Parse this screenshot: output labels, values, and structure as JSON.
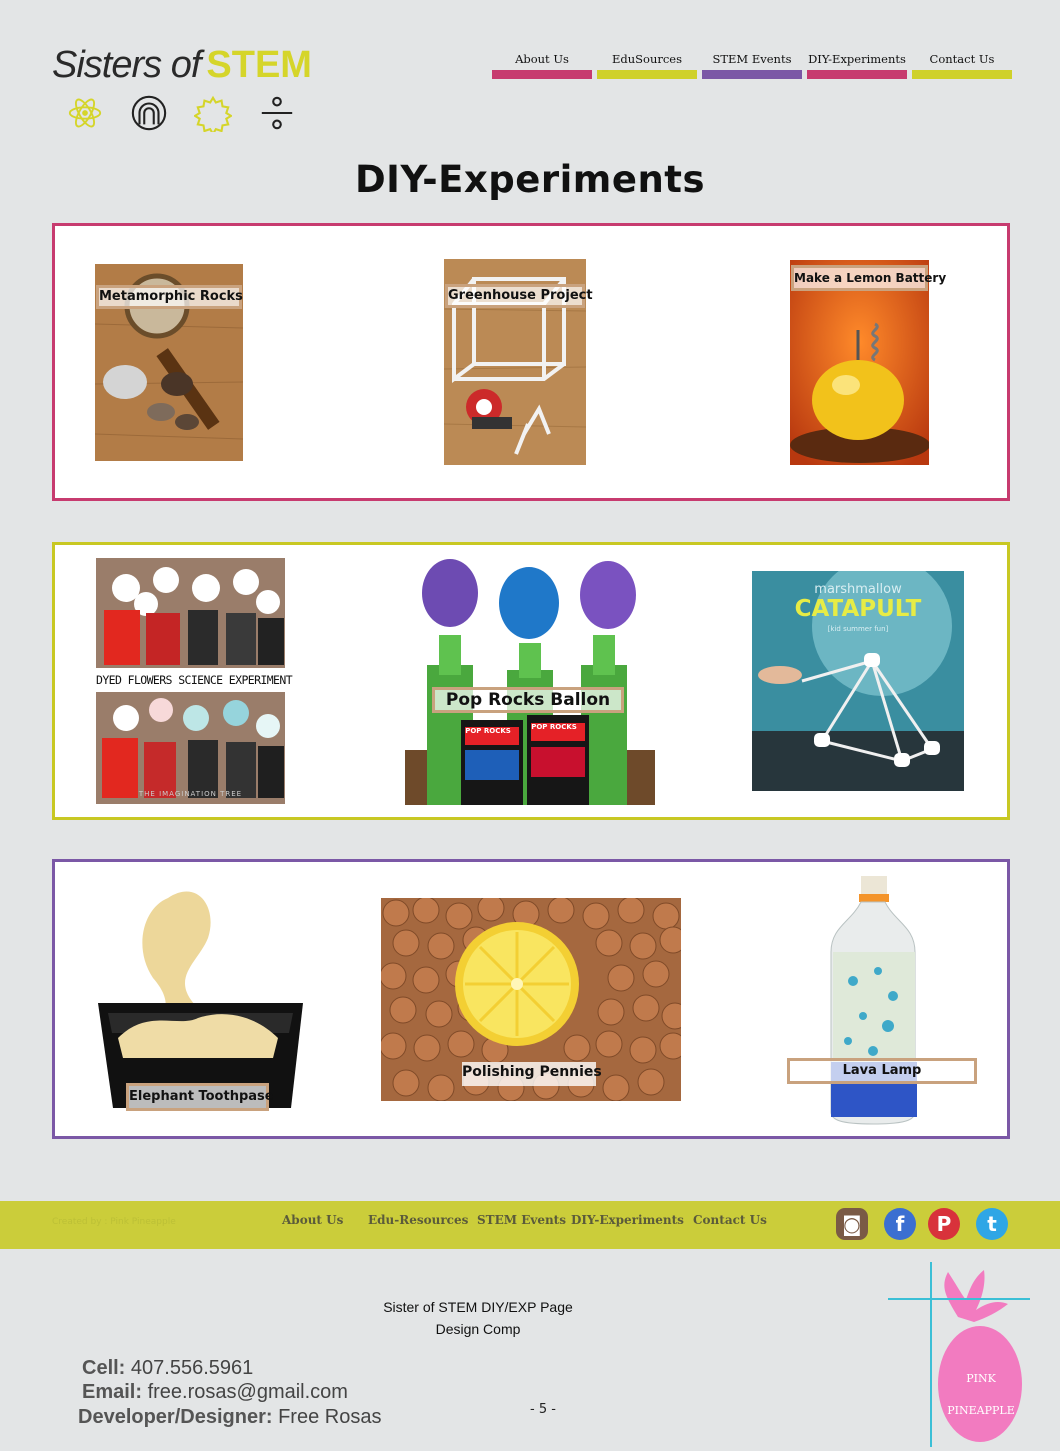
{
  "brand": {
    "name_prefix": "Sisters of",
    "name_accent": "STEM"
  },
  "nav": [
    {
      "label": "About Us",
      "color": "#c73b6f"
    },
    {
      "label": "EduSources",
      "color": "#cfd12a"
    },
    {
      "label": "STEM Events",
      "color": "#7b58a6"
    },
    {
      "label": "DIY-Experiments",
      "color": "#c73b6f"
    },
    {
      "label": "Contact Us",
      "color": "#cfd12a"
    }
  ],
  "page_title": "DIY-Experiments",
  "panels": [
    {
      "border_color": "#c73b6f"
    },
    {
      "border_color": "#c8c823"
    },
    {
      "border_color": "#7b58a6"
    }
  ],
  "experiments": [
    {
      "caption": "Metamorphic Rocks"
    },
    {
      "caption": "Greenhouse Project"
    },
    {
      "caption": "Make a Lemon Battery"
    },
    {
      "caption": "DYED FLOWERS SCIENCE EXPERIMENT",
      "watermark": "THE IMAGINATION TREE"
    },
    {
      "caption": "Pop Rocks Ballon",
      "pack_text": "POP ROCKS"
    },
    {
      "heading_small": "marshmallow",
      "heading_big": "CATAPULT",
      "subheading": "[kid summer fun]"
    },
    {
      "caption": "Elephant Toothpase"
    },
    {
      "caption": "Polishing Pennies"
    },
    {
      "caption": "Lava Lamp"
    }
  ],
  "footer": {
    "credit": "Created by : Pink Pineapple",
    "nav": [
      "About Us",
      "Edu-Resources",
      "STEM Events",
      "DIY-Experiments",
      "Contact Us"
    ],
    "social": [
      {
        "icon": "instagram-icon",
        "glyph": "◙",
        "color": "#7a5a45"
      },
      {
        "icon": "facebook-icon",
        "glyph": "f",
        "color": "#3b6fd1"
      },
      {
        "icon": "pinterest-icon",
        "glyph": "P",
        "color": "#d8323b"
      },
      {
        "icon": "twitter-icon",
        "glyph": "t",
        "color": "#2fa6e6"
      }
    ]
  },
  "comp": {
    "line1": "Sister of STEM DIY/EXP Page",
    "line2": "Design Comp"
  },
  "contact": {
    "cell_label": "Cell:",
    "cell": "407.556.5961",
    "email_label": "Email:",
    "email": "free.rosas@gmail.com",
    "dev_label": "Developer/Designer:",
    "dev": "Free Rosas"
  },
  "page_number": "- 5 -",
  "pineapple_logo": {
    "line1": "PINK",
    "line2": "PINEAPPLE"
  }
}
